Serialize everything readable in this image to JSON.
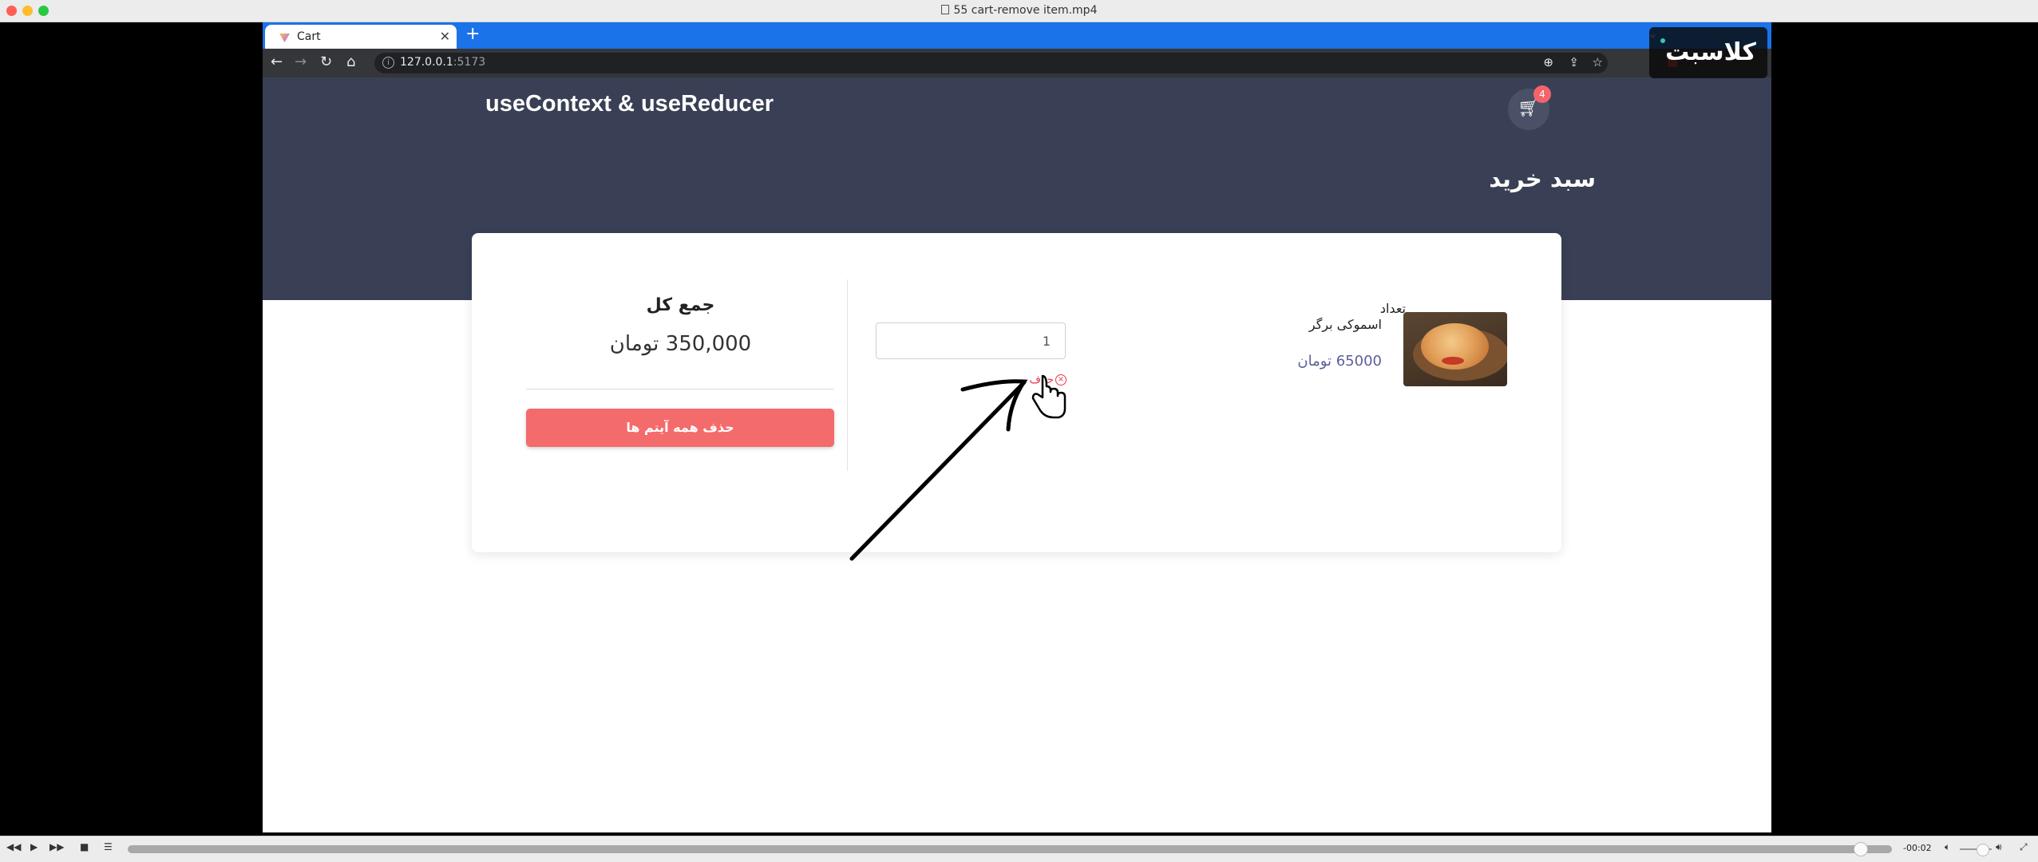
{
  "player": {
    "title": "55 cart-remove item.mp4",
    "time_remaining": "-00:02",
    "playback_progress": 0.97
  },
  "browser": {
    "tab_title": "Cart",
    "new_tab": "+",
    "url_host": "127.0.0.1",
    "url_port": ":5173"
  },
  "app": {
    "brand": "useContext & useReducer",
    "cart_count": "4",
    "page_title": "سبد خرید",
    "summary": {
      "total_label": "جمع کل",
      "total_value": "350,000 تومان",
      "clear_button": "حذف همه آیتم ها"
    },
    "item": {
      "name": "اسموکی برگر",
      "price": "65000 تومان",
      "quantity_label": "تعداد",
      "quantity_value": "1",
      "remove_label": "حذف"
    }
  },
  "watermark": {
    "text": "کلاسبت"
  },
  "colors": {
    "hero_bg": "#394055",
    "tab_bar": "#1a73e8",
    "danger": "#f46b6c",
    "badge": "#f4646a",
    "price": "#5b5f9a"
  },
  "icons": [
    "back-icon",
    "forward-icon",
    "reload-icon",
    "home-icon",
    "info-icon",
    "zoom-icon",
    "share-icon",
    "star-icon",
    "cart-icon",
    "remove-x-icon",
    "pointer-hand-icon",
    "annotation-arrow"
  ]
}
